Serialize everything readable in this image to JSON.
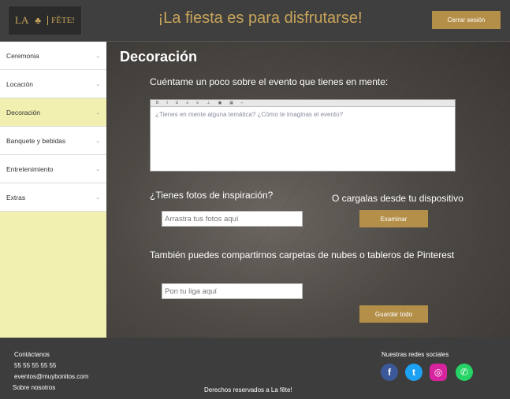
{
  "header": {
    "logo_text": "LA",
    "logo_text2": "FÊTE!",
    "tagline": "¡La fiesta es para disfrutarse!",
    "logout_label": "Cerrar sesión"
  },
  "sidebar": {
    "items": [
      {
        "label": "Ceremonia"
      },
      {
        "label": "Locación"
      },
      {
        "label": "Decoración"
      },
      {
        "label": "Banquete y bebidas"
      },
      {
        "label": "Entretenimiento"
      },
      {
        "label": "Extras"
      }
    ],
    "active_index": 2
  },
  "main": {
    "title": "Decoración",
    "prompt_label": "Cuéntame un poco sobre el evento que tienes en mente:",
    "editor_placeholder": "¿Tienes en mente alguna temática? ¿Cómo te imaginas el evento?",
    "photos_label": "¿Tienes fotos de inspiración?",
    "upload_label": "O cargalas desde tu dispositivo",
    "drop_placeholder": "Arrastra tus fotos aquí",
    "browse_label": "Examinar",
    "share_label": "También puedes compartirnos carpetas de nubes o tableros de Pinterest",
    "link_placeholder": "Pon tu liga aquí",
    "save_label": "Guardar todo"
  },
  "footer": {
    "contact_title": "Contáctanos",
    "phone": "55 55 55 55 55",
    "email": "eventos@muybonitos.com",
    "about": "Sobre nosotros",
    "rights": "Derechos reservados a La fête!",
    "social_title": "Nuestras redes sociales",
    "social": [
      {
        "icon": "facebook-icon",
        "glyph": "f",
        "color": "#3b5998"
      },
      {
        "icon": "twitter-icon",
        "glyph": "t",
        "color": "#1da1f2"
      },
      {
        "icon": "instagram-icon",
        "glyph": "◎",
        "color": "#d6249f"
      },
      {
        "icon": "whatsapp-icon",
        "glyph": "✆",
        "color": "#25d366"
      }
    ]
  },
  "colors": {
    "accent": "#b48f4a",
    "gold_text": "#c9a55a",
    "sidebar_active": "#f2f0b0"
  }
}
